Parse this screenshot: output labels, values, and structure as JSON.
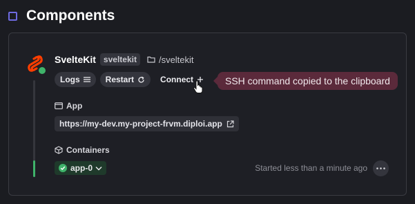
{
  "header": {
    "title": "Components"
  },
  "service": {
    "name": "SvelteKit",
    "badge": "sveltekit",
    "path": "/sveltekit",
    "logo_icon": "svelte-logo-icon",
    "status_color": "#3fb36a"
  },
  "actions": {
    "logs_label": "Logs",
    "restart_label": "Restart",
    "connect_label": "Connect"
  },
  "tooltip": {
    "text": "SSH command copied to the clipboard"
  },
  "app": {
    "label": "App",
    "url": "https://my-dev.my-project-frvm.diploi.app"
  },
  "containers": {
    "label": "Containers",
    "items": [
      {
        "name": "app-0",
        "status": "running"
      }
    ],
    "started_text": "Started less than a minute ago"
  },
  "colors": {
    "accent": "#6e6ae0",
    "success": "#3fb36a",
    "tooltip_bg": "#5b2a3b"
  }
}
